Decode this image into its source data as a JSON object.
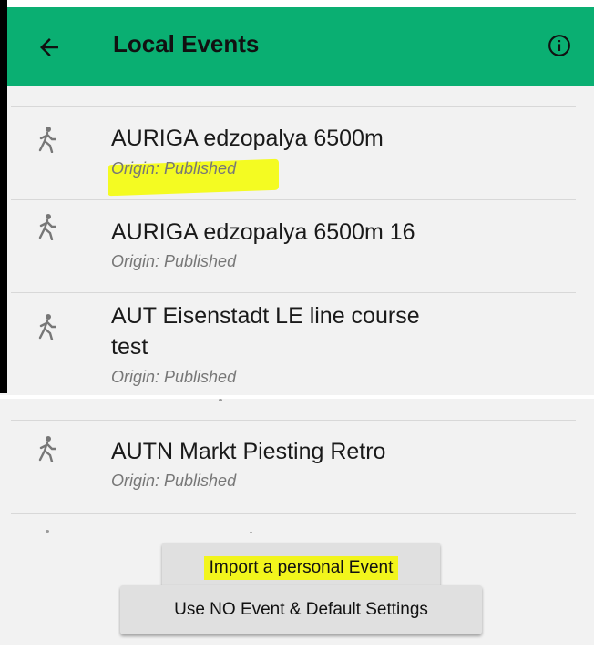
{
  "header": {
    "title": "Local Events",
    "back_icon": "arrow-left-icon",
    "info_icon": "info-circle-icon",
    "color": "#0aaf72"
  },
  "events": [
    {
      "title": "AURIGA edzopalya 6500m",
      "origin": "Origin: Published",
      "icon": "walking-person-icon"
    },
    {
      "title": "AURIGA edzopalya 6500m 16",
      "origin": "Origin: Published",
      "icon": "walking-person-icon"
    },
    {
      "title_line1": "AUT Eisenstadt LE line course",
      "title_line2": "test",
      "origin": "Origin: Published",
      "icon": "walking-person-icon"
    },
    {
      "title": "AUTN Markt Piesting Retro",
      "origin": "Origin: Published",
      "icon": "walking-person-icon"
    }
  ],
  "buttons": {
    "import_label": "Import a personal Event",
    "no_event_label": "Use NO Event & Default Settings"
  },
  "highlight_color": "#f4fb22"
}
